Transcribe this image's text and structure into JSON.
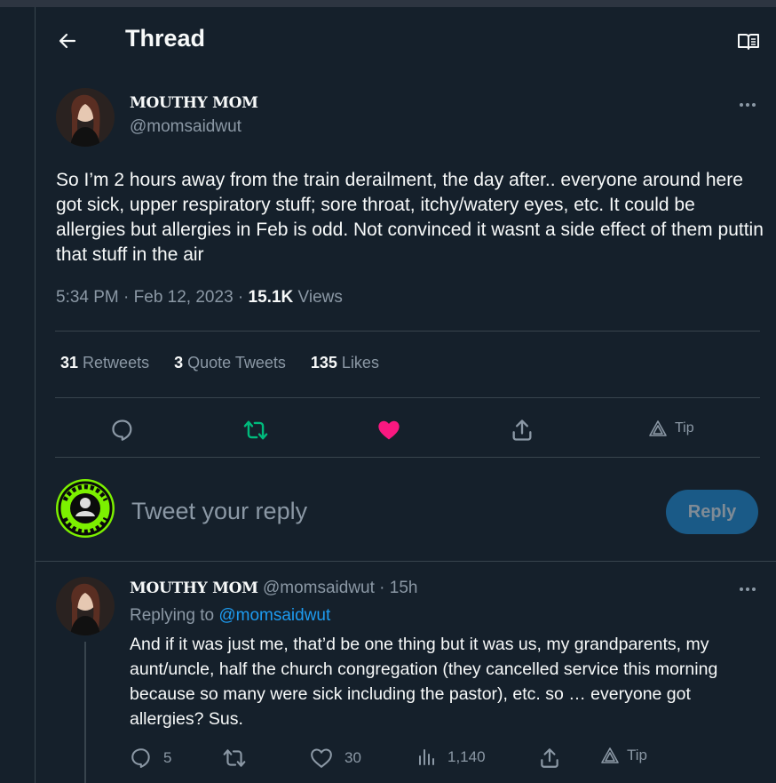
{
  "header": {
    "title": "Thread"
  },
  "tweet": {
    "display_name": "MOUTHY MOM",
    "handle": "@momsaidwut",
    "text": "So I’m 2 hours away from the train derailment, the day after.. everyone around here got sick, upper respiratory stuff; sore throat, itchy/watery eyes, etc. It could be allergies but allergies in Feb is odd. Not convinced it wasnt a side effect of them puttin that stuff in the air",
    "time": "5:34 PM",
    "date": "Feb 12, 2023",
    "views_count": "15.1K",
    "views_label": "Views",
    "stats": {
      "retweets_count": "31",
      "retweets_label": "Retweets",
      "quotes_count": "3",
      "quotes_label": "Quote Tweets",
      "likes_count": "135",
      "likes_label": "Likes"
    },
    "tip_label": "Tip"
  },
  "composer": {
    "placeholder": "Tweet your reply",
    "button_label": "Reply"
  },
  "reply": {
    "display_name": "MOUTHY MOM",
    "handle": "@momsaidwut",
    "age": "15h",
    "replying_label": "Replying to",
    "replying_to": "@momsaidwut",
    "text": "And if it was just me, that’d be one thing but it was us, my grandparents, my aunt/uncle, half the church congregation (they cancelled service this morning because so many were sick including the pastor), etc. so … everyone got allergies? Sus.",
    "replies": "5",
    "likes": "30",
    "views": "1,140",
    "tip_label": "Tip"
  },
  "colors": {
    "background": "#15202b",
    "retweet_active": "#00ba7c",
    "like_active": "#f91880",
    "link": "#1d9bf0",
    "reply_button": "#1a5a87"
  },
  "icons": [
    "back-arrow-icon",
    "reader-mode-icon",
    "more-icon",
    "reply-icon",
    "retweet-icon",
    "like-icon",
    "share-icon",
    "tip-icon",
    "views-icon"
  ]
}
